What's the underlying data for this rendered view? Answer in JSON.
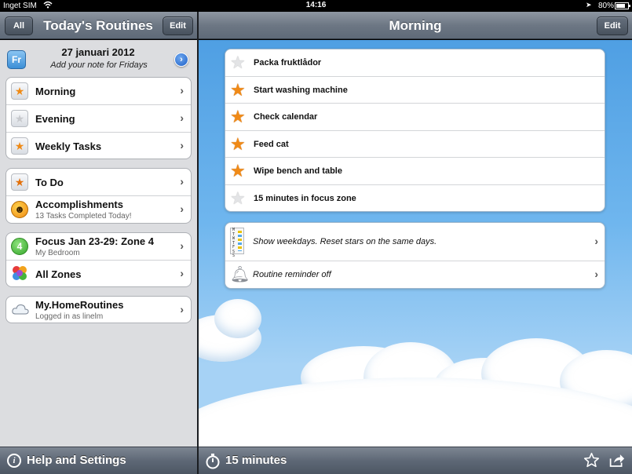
{
  "status_bar": {
    "carrier": "Inget SIM",
    "time": "14:16",
    "battery": "80%",
    "battery_level": 0.8
  },
  "left_toolbar": {
    "all_button": "All",
    "title": "Today's Routines",
    "edit_button": "Edit"
  },
  "right_toolbar": {
    "title": "Morning",
    "edit_button": "Edit"
  },
  "date_row": {
    "day_icon": "Fr",
    "date": "27 januari 2012",
    "note": "Add your note for Fridays"
  },
  "routines": [
    {
      "label": "Morning",
      "icon": "star-icon"
    },
    {
      "label": "Evening",
      "icon": "star-icon"
    },
    {
      "label": "Weekly Tasks",
      "icon": "star-icon"
    }
  ],
  "todo_group": {
    "todo_label": "To Do",
    "accomplishments_label": "Accomplishments",
    "accomplishments_sub": "13 Tasks Completed Today!"
  },
  "zones_group": {
    "focus_badge": "4",
    "focus_label": "Focus Jan 23-29: Zone 4",
    "focus_sub": "My Bedroom",
    "all_zones_label": "All Zones"
  },
  "account": {
    "label": "My.HomeRoutines",
    "sub": "Logged in as linelm"
  },
  "tasks": [
    {
      "label": "Packa fruktlådor",
      "starred": false
    },
    {
      "label": "Start washing machine",
      "starred": true
    },
    {
      "label": "Check calendar",
      "starred": true
    },
    {
      "label": "Feed cat",
      "starred": true
    },
    {
      "label": "Wipe bench and table",
      "starred": true
    },
    {
      "label": "15 minutes in focus zone",
      "starred": false
    }
  ],
  "settings": {
    "weekdays_icon": "M T W T F S S",
    "weekdays_label": "Show weekdays. Reset stars on the same days.",
    "reminder_label": "Routine reminder off"
  },
  "left_bottom": {
    "label": "Help and Settings"
  },
  "right_bottom": {
    "timer_label": "15 minutes"
  },
  "colors": {
    "toolbar": "#6d7784",
    "star_on": "#f08a17",
    "sky": "#4f9fe3"
  }
}
